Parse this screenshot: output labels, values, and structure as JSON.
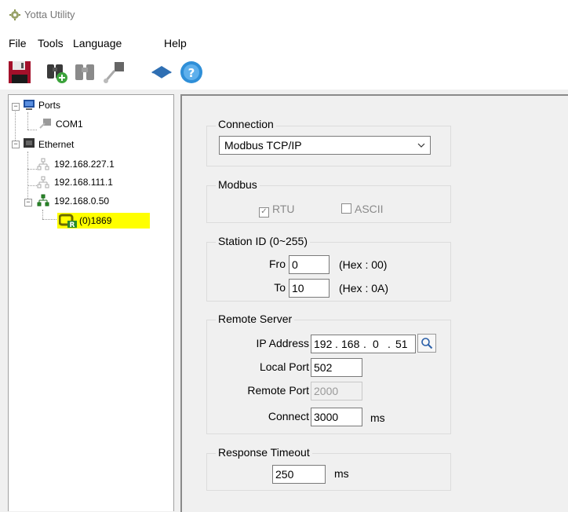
{
  "window": {
    "title": "Yotta Utility"
  },
  "menu": {
    "file": "File",
    "tools": "Tools",
    "language": "Language",
    "help": "Help"
  },
  "toolbar": {
    "icons": [
      "save-icon",
      "binoculars-add-icon",
      "binoculars-icon",
      "connect-plug-icon",
      "book-icon",
      "help-icon"
    ]
  },
  "tree": {
    "ports": "Ports",
    "com1": "COM1",
    "ethernet": "Ethernet",
    "net1": "192.168.227.1",
    "net2": "192.168.111.1",
    "net3": "192.168.0.50",
    "device": "(0)1869",
    "device_highlight": "#ffff00"
  },
  "connection": {
    "title": "Connection",
    "selected": "Modbus TCP/IP"
  },
  "modbus": {
    "title": "Modbus",
    "rtu_label": "RTU",
    "rtu_checked": true,
    "ascii_label": "ASCII",
    "ascii_checked": false
  },
  "station": {
    "title": "Station ID (0~255)",
    "from_label": "Fro",
    "from_value": "0",
    "from_hex": "(Hex : 00)",
    "to_label": "To",
    "to_value": "10",
    "to_hex": "(Hex : 0A)"
  },
  "remote": {
    "title": "Remote Server",
    "ip_label": "IP Address",
    "ip1": "192",
    "ip2": "168",
    "ip3": "0",
    "ip4": "51",
    "local_port_label": "Local Port",
    "local_port": "502",
    "remote_port_label": "Remote Port",
    "remote_port": "2000",
    "connect_label": "Connect",
    "connect": "3000",
    "connect_unit": "ms"
  },
  "timeout": {
    "title": "Response Timeout",
    "value": "250",
    "unit": "ms"
  }
}
